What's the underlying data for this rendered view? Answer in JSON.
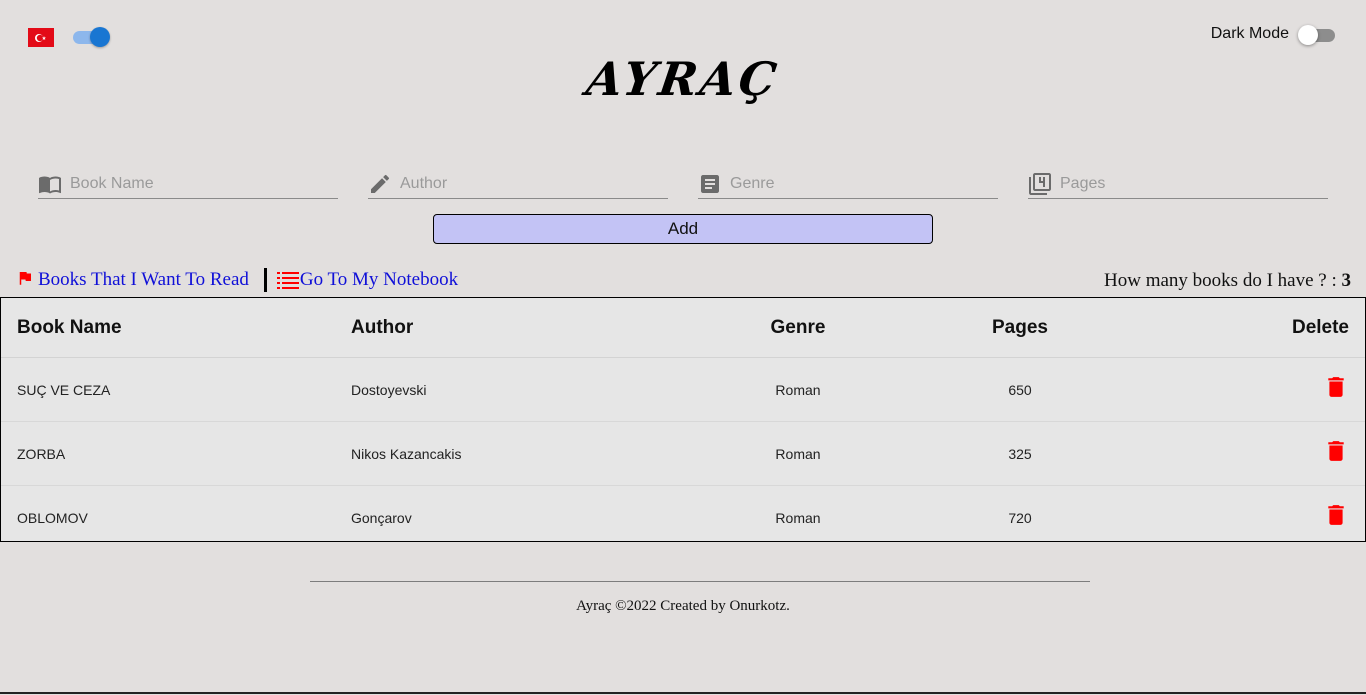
{
  "header": {
    "language_flag": "turkey-flag",
    "language_toggle_on": true,
    "dark_mode_label": "Dark Mode",
    "dark_mode_on": false,
    "logo_text": "AYRAÇ"
  },
  "form": {
    "book_name_placeholder": "Book Name",
    "author_placeholder": "Author",
    "genre_placeholder": "Genre",
    "pages_placeholder": "Pages",
    "add_label": "Add"
  },
  "links": {
    "want_to_read": "Books That I Want To Read",
    "notebook": "Go To My Notebook"
  },
  "count": {
    "label": "How many books do I have ? :",
    "value": "3"
  },
  "table": {
    "headers": [
      "Book Name",
      "Author",
      "Genre",
      "Pages",
      "Delete"
    ],
    "rows": [
      {
        "name": "SUÇ VE CEZA",
        "author": "Dostoyevski",
        "genre": "Roman",
        "pages": "650"
      },
      {
        "name": "ZORBA",
        "author": "Nikos Kazancakis",
        "genre": "Roman",
        "pages": "325"
      },
      {
        "name": "OBLOMOV",
        "author": "Gonçarov",
        "genre": "Roman",
        "pages": "720"
      }
    ]
  },
  "footer": {
    "text": "Ayraç ©2022 Created by Onurkotz."
  },
  "colors": {
    "background": "#e2dfde",
    "add_button": "#c3c3f5",
    "link": "#1010d8",
    "delete_icon": "#ff0000",
    "toggle_on": "#1976d2"
  }
}
